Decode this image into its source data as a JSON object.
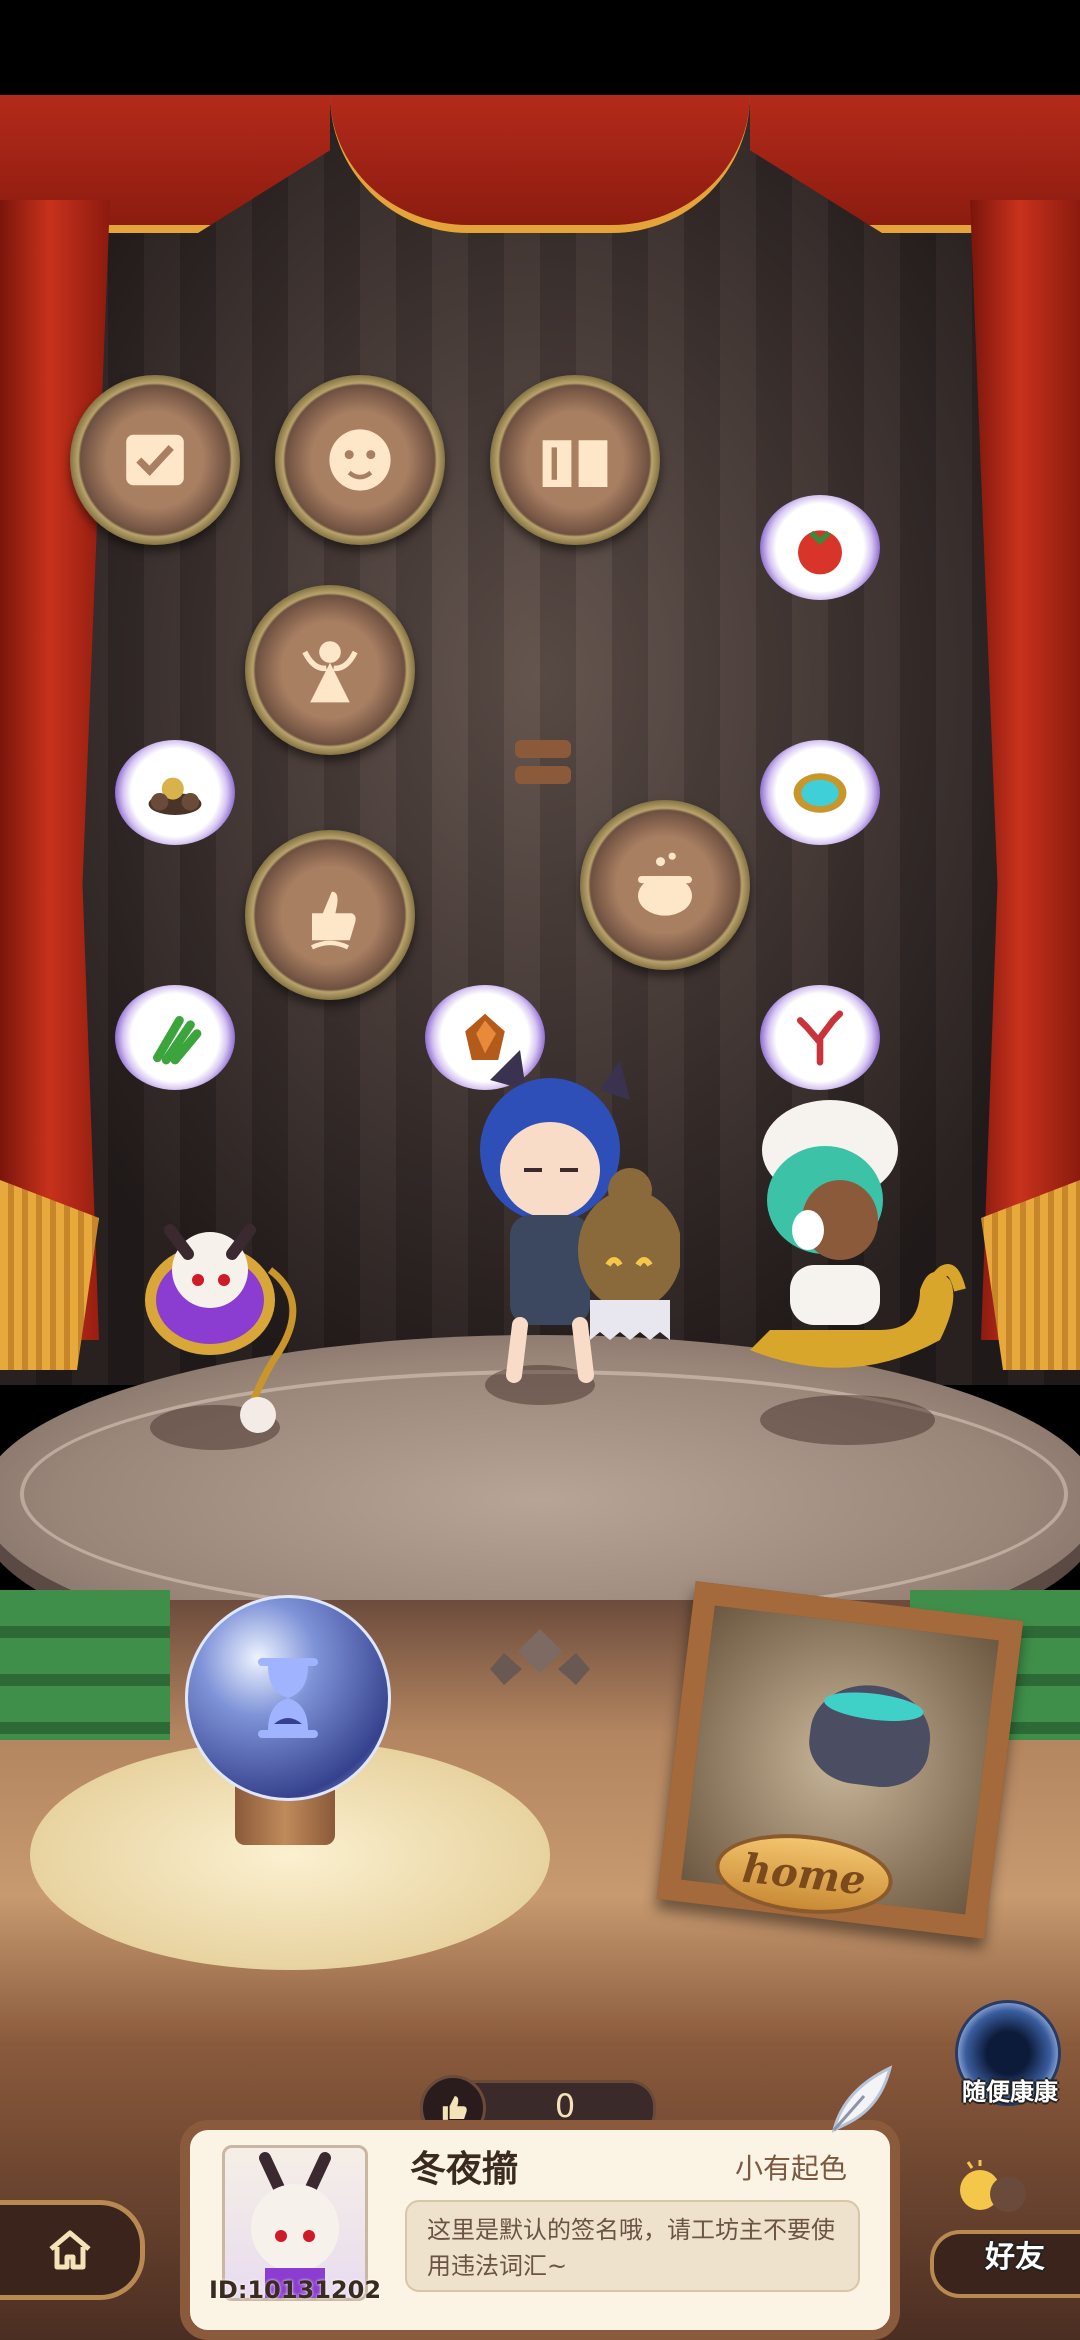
{
  "stage": {
    "home_plate_label": "home"
  },
  "badges": [
    {
      "name": "scroll-contract-badge"
    },
    {
      "name": "lion-face-badge"
    },
    {
      "name": "book-badge"
    },
    {
      "name": "fairy-silhouette-badge"
    },
    {
      "name": "thumb-up-sprout-badge"
    },
    {
      "name": "cauldron-badge"
    }
  ],
  "thought_bubbles": [
    {
      "name": "tomato-bubble"
    },
    {
      "name": "ore-pile-bubble"
    },
    {
      "name": "magic-mirror-bubble"
    },
    {
      "name": "green-leek-bubble"
    },
    {
      "name": "amber-crystal-bubble"
    },
    {
      "name": "red-coral-bubble"
    }
  ],
  "likes": {
    "count": "0"
  },
  "player": {
    "name": "冬夜擶",
    "rank": "小有起色",
    "id": "ID:10131202",
    "signature": "这里是默认的签名哦，请工坊主不要使用违法词汇~"
  },
  "buttons": {
    "random_visit": "随便康康",
    "friends": "好友"
  },
  "colors": {
    "curtain_red": "#b42a1a",
    "fringe_gold": "#e8a93c",
    "card_bg": "#fbf3e4",
    "frame_brown": "#8a5a3c"
  }
}
